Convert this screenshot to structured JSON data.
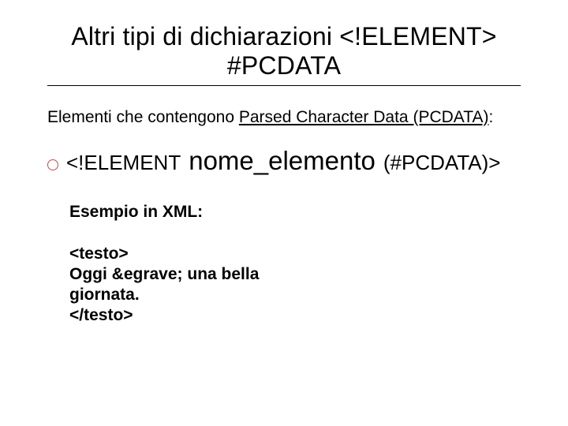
{
  "title": {
    "line1": "Altri tipi di dichiarazioni <!ELEMENT>",
    "line2": "#PCDATA"
  },
  "intro": {
    "prefix": "Elementi che contengono ",
    "underlined": "Parsed Character Data (PCDATA)",
    "suffix": ":"
  },
  "bullet": {
    "elem": "<!ELEMENT",
    "name": "nome_elemento",
    "pc": "(#PCDATA)>"
  },
  "subhead": "Esempio in XML:",
  "code": {
    "l1": "<testo>",
    "l2": "Oggi &egrave; una bella giornata.",
    "l3": "</testo>"
  }
}
